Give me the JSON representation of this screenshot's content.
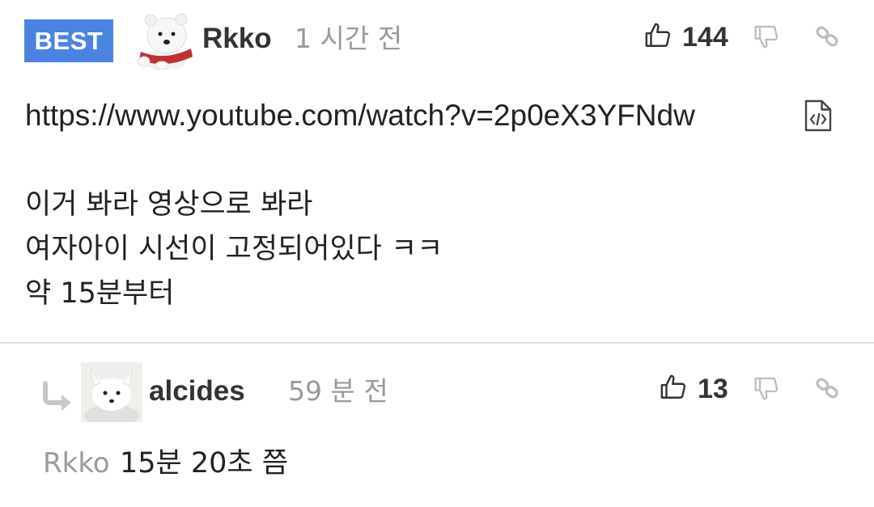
{
  "comments": [
    {
      "badge": "BEST",
      "avatar": "polar-bear-avatar",
      "username": "Rkko",
      "time": "1 시간 전",
      "likes": "144",
      "link_text": "https://www.youtube.com/watch?v=2p0eX3YFNdw",
      "lines": [
        "이거 봐라 영상으로 봐라",
        "여자아이 시선이 고정되어있다 ㅋㅋ",
        "약 15분부터"
      ]
    },
    {
      "avatar": "arctic-fox-avatar",
      "username": "alcides",
      "time": "59 분 전",
      "likes": "13",
      "reply_to": "Rkko",
      "text": "15분 20초 쯤"
    }
  ],
  "colors": {
    "badge": "#4a84e0",
    "muted": "#9a9a9a",
    "text": "#222222",
    "divider": "#e0e0e0"
  },
  "icons": [
    "thumbs-up-icon",
    "thumbs-down-icon",
    "link-icon",
    "embed-code-icon",
    "reply-arrow-icon"
  ]
}
